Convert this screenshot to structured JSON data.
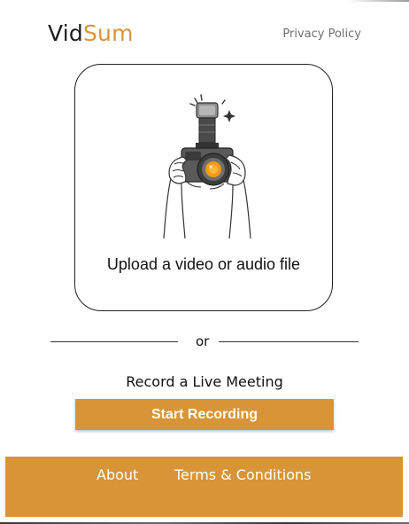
{
  "brand": {
    "name_part1": "Vid",
    "name_part2": "Sum",
    "accent_color": "#d99437"
  },
  "header": {
    "privacy_link": "Privacy Policy"
  },
  "upload": {
    "label": "Upload a video or audio file",
    "illustration_icon": "camera-hands-illustration"
  },
  "divider": {
    "text": "or"
  },
  "record": {
    "title": "Record a Live Meeting",
    "button_label": "Start Recording"
  },
  "footer": {
    "links": [
      "About",
      "Terms & Conditions"
    ]
  }
}
